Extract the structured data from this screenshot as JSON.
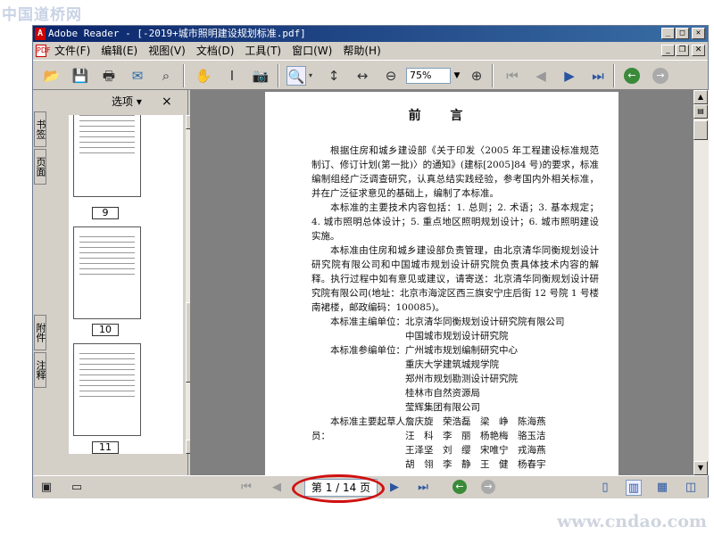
{
  "watermark_top": "中国道桥网",
  "watermark_bottom": "www.cndao.com",
  "window": {
    "title": "Adobe Reader - [-2019+城市照明建设规划标准.pdf]"
  },
  "menu": [
    "文件(F)",
    "编辑(E)",
    "视图(V)",
    "文档(D)",
    "工具(T)",
    "窗口(W)",
    "帮助(H)"
  ],
  "toolbar": {
    "zoom": "75%"
  },
  "left_tabs": {
    "bookmarks": "书签",
    "pages": "页面",
    "attachments": "附件",
    "comments": "注释"
  },
  "nav_panel": {
    "options": "选项 ▾",
    "close": "×",
    "pages": [
      "9",
      "10",
      "11"
    ]
  },
  "document": {
    "title": "前 言",
    "paragraphs": [
      "根据住房和城乡建设部《关于印发〈2005 年工程建设标准规范制订、修订计划(第一批)〉的通知》(建标[2005]84 号)的要求，标准编制组经广泛调查研究，认真总结实践经验，参考国内外相关标准，并在广泛征求意见的基础上，编制了本标准。",
      "本标准的主要技术内容包括：1. 总则；2. 术语；3. 基本规定；4. 城市照明总体设计；5. 重点地区照明规划设计；6. 城市照明建设实施。",
      "本标准由住房和城乡建设部负责管理，由北京清华同衡规划设计研究院有限公司和中国城市规划设计研究院负责具体技术内容的解释。执行过程中如有意见或建议，请寄送：北京清华同衡规划设计研究院有限公司(地址：北京市海淀区西三旗安宁庄后街 12 号院 1 号楼南裙楼，邮政编码：100085)。"
    ],
    "chief_label": "本标准主编单位：",
    "chief_units": [
      "北京清华同衡规划设计研究院有限公司",
      "中国城市规划设计研究院"
    ],
    "participating_label": "本标准参编单位：",
    "participating_units": [
      "广州城市规划编制研究中心",
      "重庆大学建筑城规学院",
      "郑州市规划勘测设计研究院",
      "桂林市自然资源局",
      "莹辉集团有限公司"
    ],
    "drafters_label": "本标准主要起草人员：",
    "drafters": [
      "詹庆旋　荣浩磊　梁　峥　陈海燕",
      "汪　科　李　丽　杨艳梅　骆玉洁",
      "王泽坚　刘　缨　宋唯宁　戎海燕",
      "胡　翎　李　静　王　健　杨春宇"
    ]
  },
  "status": {
    "page_indicator": "第 1 / 14 页"
  },
  "colors": {
    "highlight": "#d01010",
    "titlebar": "#0a246a",
    "nav_green": "#3a8a3a"
  }
}
